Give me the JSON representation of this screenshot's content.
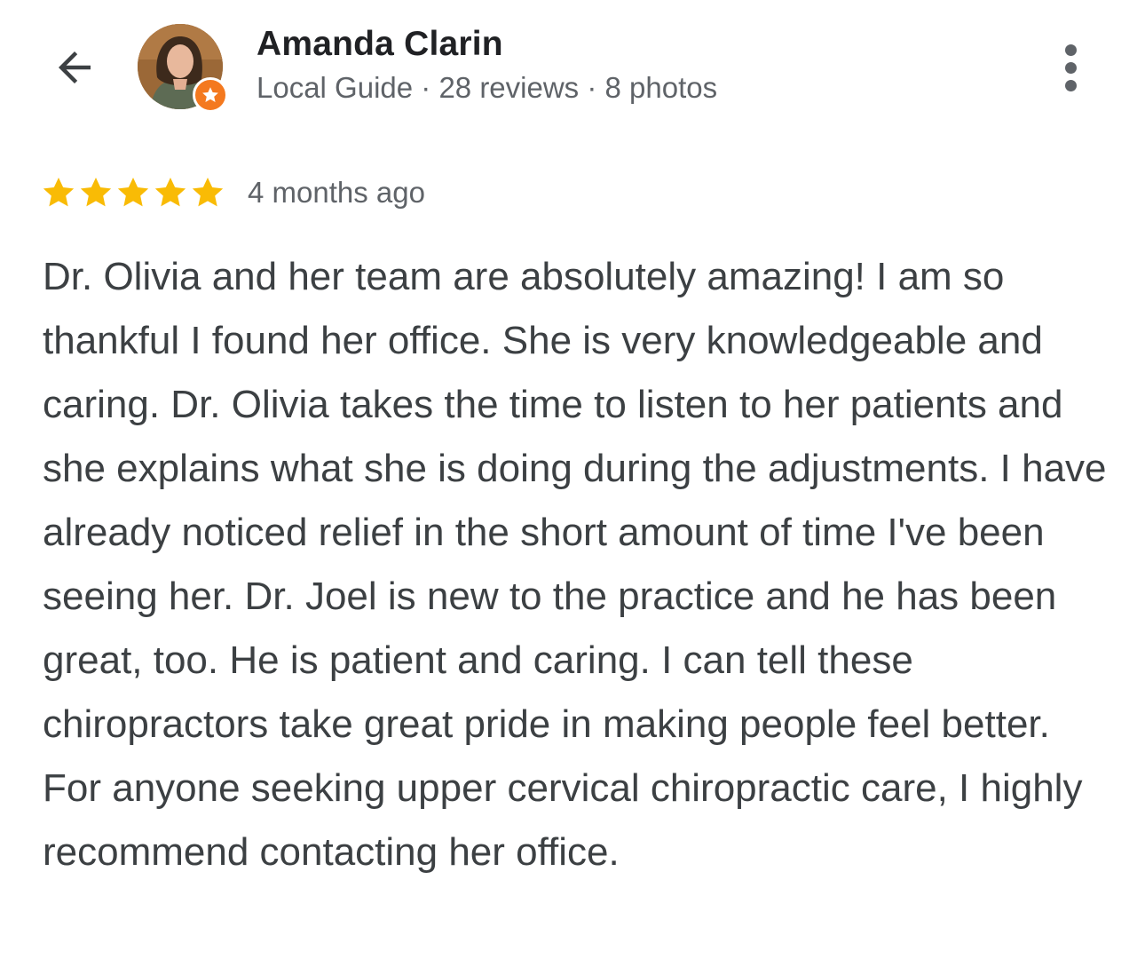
{
  "reviewer": {
    "name": "Amanda Clarin",
    "meta": "Local Guide · 28 reviews · 8 photos",
    "badge": "local-guide-star-badge"
  },
  "icons": {
    "back": "arrow-back-icon",
    "more": "more-vert-icon",
    "star": "star-icon"
  },
  "review": {
    "rating": 5,
    "rating_max": 5,
    "time": "4 months ago",
    "text": "Dr. Olivia and her team are absolutely amazing! I am so thankful I found her office. She is very knowledgeable and caring. Dr. Olivia takes the time to listen to her patients and she explains what she is doing during the adjustments. I have already noticed relief in the short amount of time I've been seeing her. Dr. Joel is new to the practice and he has been great, too. He is patient and caring. I can tell these chiropractors take great pride in making people feel better. For anyone seeking upper cervical chiropractic care, I highly recommend contacting her office."
  },
  "colors": {
    "star": "#f9bb05",
    "badge": "#f4791f",
    "name": "#202124",
    "secondary": "#5f6368",
    "body": "#3c4043"
  }
}
